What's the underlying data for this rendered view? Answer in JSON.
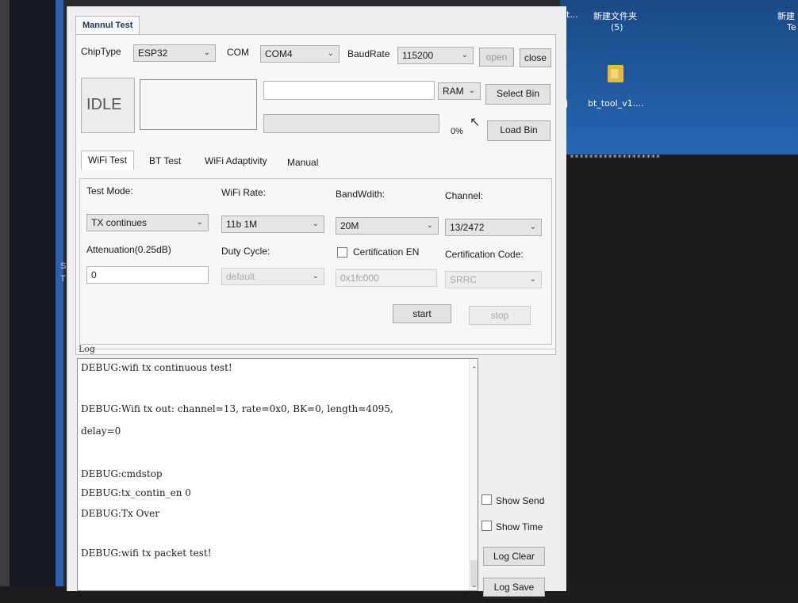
{
  "desktop": {
    "top_left_text": "t...",
    "folder_label": "新建文件夹",
    "folder_sub": "(5)",
    "right_text": "新建",
    "right_sub": "Te",
    "icon_label": "bt_tool_v1....",
    "edge_char": "j",
    "stars": "*******************",
    "strip_chars": [
      "S",
      "T"
    ]
  },
  "window": {
    "tab_label": "Mannul Test"
  },
  "connection": {
    "chiptype_label": "ChipType",
    "chiptype_value": "ESP32",
    "com_label": "COM",
    "com_value": "COM4",
    "baud_label": "BaudRate",
    "baud_value": "115200",
    "open_label": "open",
    "close_label": "close"
  },
  "loader": {
    "status": "IDLE",
    "mem_value": "RAM",
    "select_bin_label": "Select Bin",
    "load_bin_label": "Load Bin",
    "progress_percent_text": "0%",
    "progress": 0
  },
  "tabs": [
    "WiFi Test",
    "BT Test",
    "WiFi Adaptivity",
    "Manual"
  ],
  "wifi": {
    "test_mode_label": "Test Mode:",
    "test_mode_value": "TX continues",
    "rate_label": "WiFi Rate:",
    "rate_value": "11b 1M",
    "bandwidth_label": "BandWdith:",
    "bandwidth_value": "20M",
    "channel_label": "Channel:",
    "channel_value": "13/2472",
    "atten_label": "Attenuation(0.25dB)",
    "atten_value": "0",
    "duty_label": "Duty Cycle:",
    "duty_value": "default",
    "cert_en_label": "Certification EN",
    "cert_en_checked": false,
    "cert_code_label": "Certification Code:",
    "cert_addr_value": "0x1fc000",
    "cert_code_value": "SRRC",
    "start_label": "start",
    "stop_label": "stop"
  },
  "log": {
    "title": "Log",
    "lines": [
      "DEBUG:wifi tx continuous test!",
      "DEBUG:Wifi tx out: channel=13, rate=0x0, BK=0, length=4095,",
      "delay=0",
      "DEBUG:cmdstop",
      "DEBUG:tx_contin_en 0",
      "DEBUG:Tx Over",
      "DEBUG:wifi tx packet test!"
    ],
    "show_send_label": "Show Send",
    "show_send_checked": false,
    "show_time_label": "Show Time",
    "show_time_checked": false,
    "clear_label": "Log Clear",
    "save_label": "Log Save"
  }
}
